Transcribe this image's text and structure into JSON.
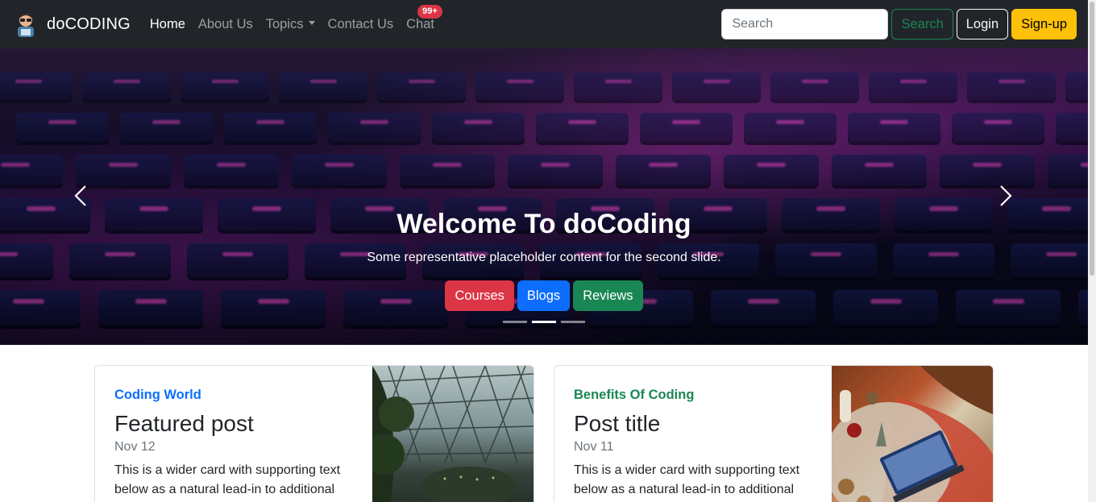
{
  "navbar": {
    "brand": "doCODING",
    "links": [
      {
        "label": "Home"
      },
      {
        "label": "About Us"
      },
      {
        "label": "Topics"
      },
      {
        "label": "Contact Us"
      },
      {
        "label": "Chat",
        "badge": "99+"
      }
    ],
    "search_placeholder": "Search",
    "search_button": "Search",
    "login": "Login",
    "signup": "Sign-up"
  },
  "carousel": {
    "title": "Welcome To doCoding",
    "subtitle": "Some representative placeholder content for the second slide.",
    "buttons": [
      "Courses",
      "Blogs",
      "Reviews"
    ],
    "active_slide": 2,
    "slide_count": 3
  },
  "cards": [
    {
      "category": "Coding World",
      "title": "Featured post",
      "date": "Nov 12",
      "text": "This is a wider card with supporting text below as a natural lead-in to additional",
      "image": "glass-dome-image"
    },
    {
      "category": "Benefits Of Coding",
      "title": "Post title",
      "date": "Nov 11",
      "text": "This is a wider card with supporting text below as a natural lead-in to additional",
      "image": "laptop-desk-image"
    }
  ],
  "colors": {
    "navbar_bg": "#212529",
    "primary": "#0d6efd",
    "success": "#198754",
    "danger": "#dc3545",
    "warning": "#ffc107"
  }
}
